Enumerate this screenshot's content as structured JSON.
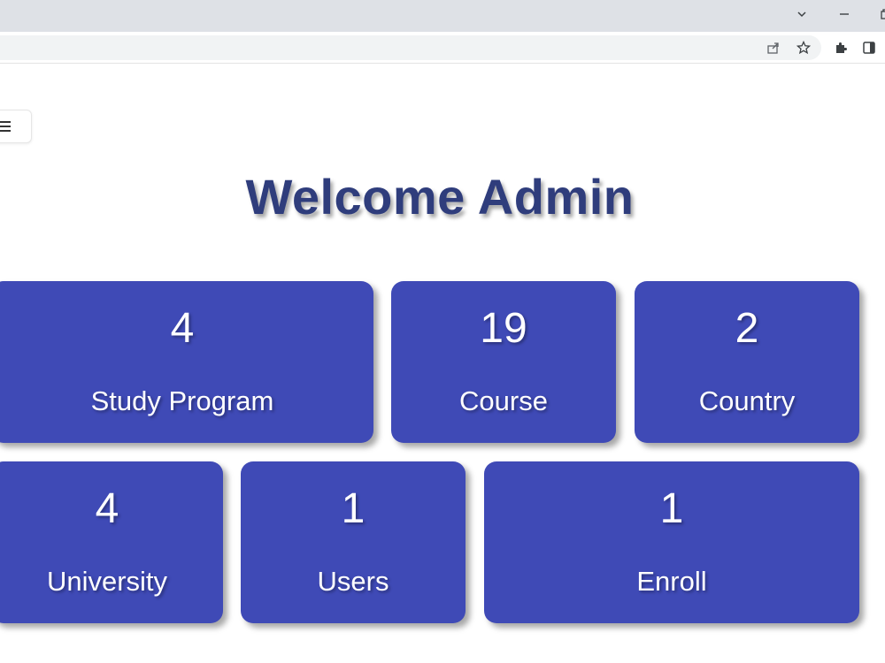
{
  "page": {
    "title": "Welcome Admin"
  },
  "cards": {
    "study_program": {
      "count": "4",
      "label": "Study Program"
    },
    "course": {
      "count": "19",
      "label": "Course"
    },
    "country": {
      "count": "2",
      "label": "Country"
    },
    "university": {
      "count": "4",
      "label": "University"
    },
    "users": {
      "count": "1",
      "label": "Users"
    },
    "enroll": {
      "count": "1",
      "label": "Enroll"
    }
  },
  "icons": {
    "tab_search": "chevron-down-icon",
    "minimize": "minimize-icon",
    "share": "share-icon",
    "bookmark": "star-icon",
    "extensions": "puzzle-icon",
    "side_panel": "side-panel-icon",
    "menu": "hamburger-menu-icon"
  },
  "colors": {
    "card_bg": "#3f4ab6",
    "title": "#2f3d7c",
    "chrome_bg": "#dee1e6"
  }
}
